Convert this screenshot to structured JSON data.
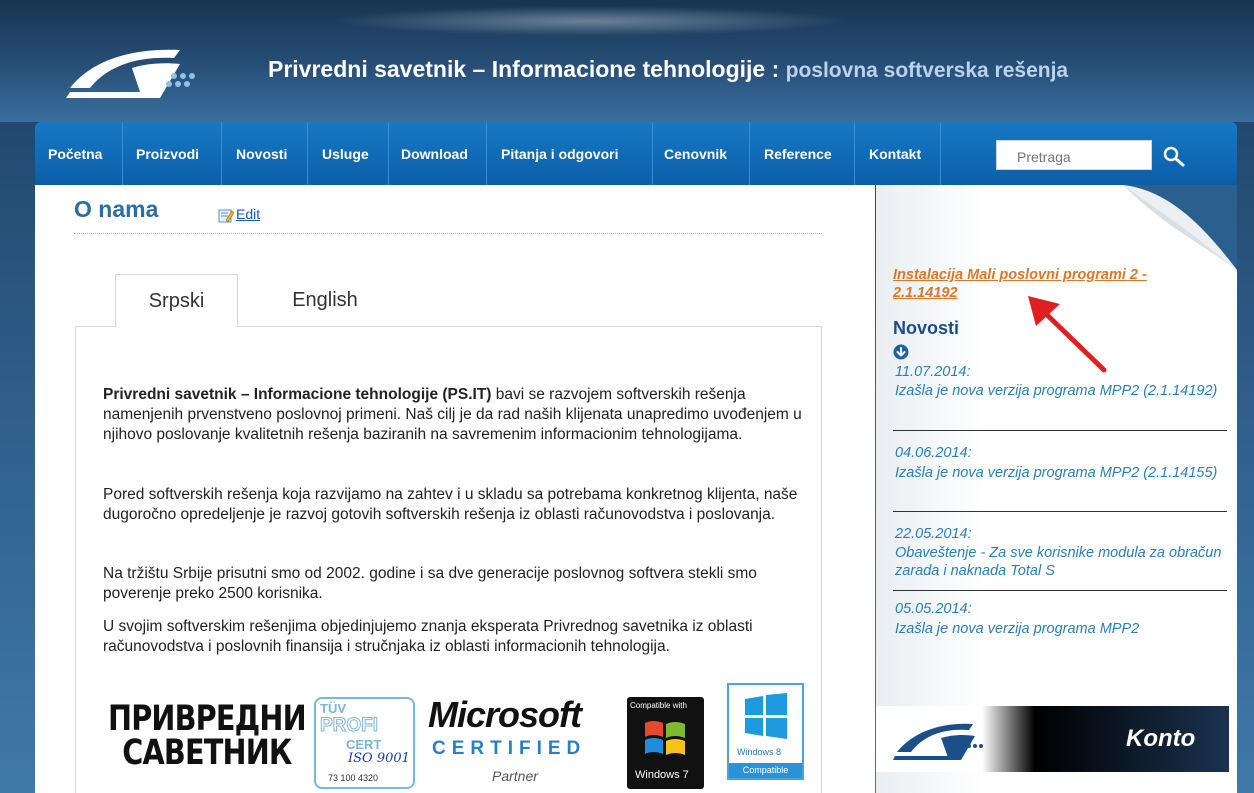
{
  "header": {
    "title": "Privredni savetnik – Informacione tehnologije",
    "separator": " : ",
    "subtitle": "poslovna softverska rešenja"
  },
  "nav": {
    "items": [
      "Početna",
      "Proizvodi",
      "Novosti",
      "Usluge",
      "Download",
      "Pitanja i odgovori",
      "Cenovnik",
      "Reference",
      "Kontakt"
    ],
    "search_placeholder": "Pretraga"
  },
  "page": {
    "title": "O nama",
    "edit_label": "Edit"
  },
  "tabs": [
    "Srpski",
    "English"
  ],
  "active_tab": "Srpski",
  "body": {
    "p1_bold": "Privredni savetnik – Informacione tehnologije (PS.IT)",
    "p1_rest": " bavi se razvojem softverskih rešenja namenjenih prvenstveno poslovnoj primeni. Naš cilj je da rad naših klijenata unapredimo uvođenjem u njihovo poslovanje kvalitetnih rešenja baziranih na savremenim informacionim tehnologijama.",
    "p2": "Pored softverskih rešenja koja razvijamo na zahtev i u skladu sa potrebama konkretnog klijenta, naše dugoročno opredeljenje je razvoj gotovih softverskih rešenja iz oblasti računovodstva i poslovanja.",
    "p3": "Na tržištu Srbije prisutni smo od 2002. godine i sa dve generacije poslovnog softvera stekli smo poverenje preko 2500 korisnika.",
    "p4": "U svojim softverskim rešenjima objedinjujemo znanja eksperata Privrednog savetnika iz oblasti računovodstva i poslovnih finansija i stručnjaka iz oblasti informacionih tehnologija."
  },
  "logos": {
    "pv_line1": "ПРИВРЕДНИ",
    "pv_line2": "САВЕТНИК",
    "tuv_top": "TÜV",
    "tuv_mid": "PROFI",
    "tuv_cert": "CERT",
    "tuv_iso": "ISO 9001",
    "tuv_num": "73 100 4320",
    "ms_name": "Microsoft",
    "ms_certified": "CERTIFIED",
    "ms_partner": "Partner",
    "win7_top": "Compatible with",
    "win7_name": "Windows 7",
    "win8_name": "Windows 8",
    "win8_compat": "Compatible"
  },
  "sidebar": {
    "install_link": "Instalacija Mali poslovni programi 2 - 2.1.14192",
    "news_title": "Novosti",
    "news": [
      {
        "date": "11.07.2014:",
        "text": "Izašla je nova verzija programa MPP2 (2.1.14192)"
      },
      {
        "date": "04.06.2014:",
        "text": "Izašla je nova verzija programa MPP2 (2.1.14155)"
      },
      {
        "date": "22.05.2014:",
        "text": "Obaveštenje - Za sve korisnike modula za obračun zarada i naknada Total S"
      },
      {
        "date": "05.05.2014:",
        "text": "Izašla je nova verzija programa MPP2"
      }
    ],
    "konto_label": "Konto"
  },
  "colors": {
    "nav_blue": "#0b6bb8",
    "title_blue": "#2b6ea5",
    "link_orange": "#d9782a",
    "news_blue": "#2a7fb8",
    "arrow_red": "#e02020"
  }
}
